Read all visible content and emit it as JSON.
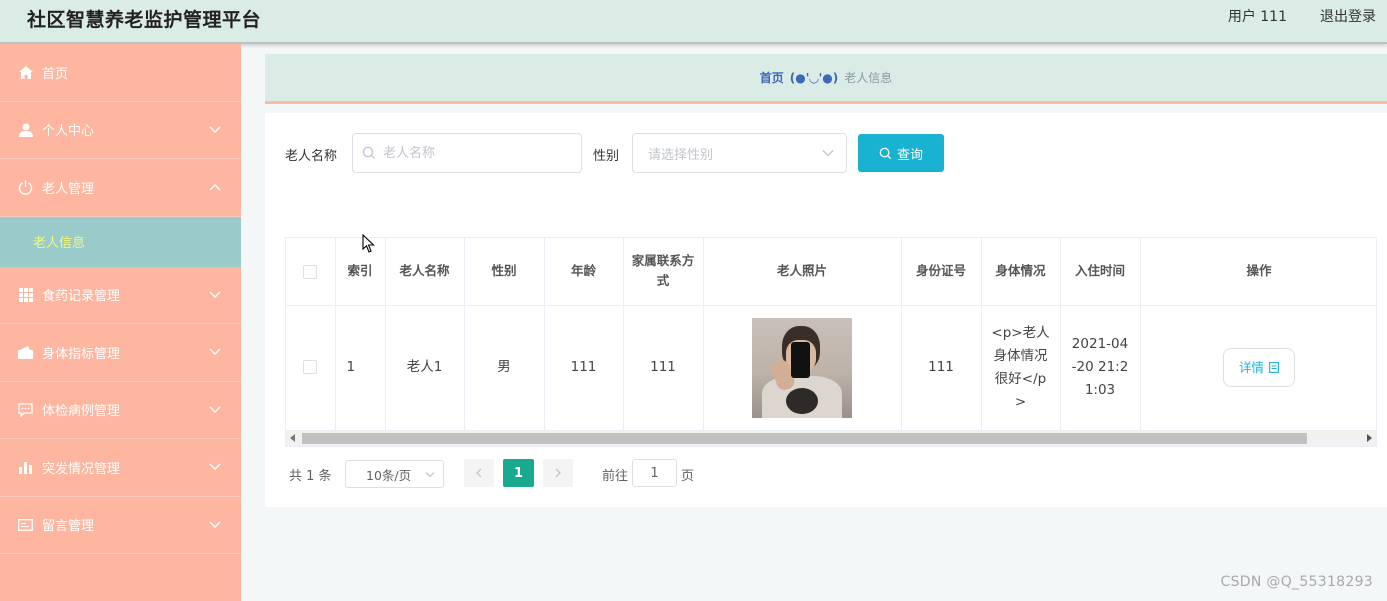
{
  "header": {
    "title": "社区智慧养老监护管理平台",
    "user": "用户 111",
    "logout": "退出登录"
  },
  "sidebar": {
    "items": [
      {
        "label": "首页",
        "icon": "home-icon"
      },
      {
        "label": "个人中心",
        "icon": "user-icon"
      },
      {
        "label": "老人管理",
        "icon": "power-icon"
      },
      {
        "label": "食药记录管理",
        "icon": "grid-icon"
      },
      {
        "label": "身体指标管理",
        "icon": "wallet-icon"
      },
      {
        "label": "体检病例管理",
        "icon": "chat-icon"
      },
      {
        "label": "突发情况管理",
        "icon": "bar-chart-icon"
      },
      {
        "label": "留言管理",
        "icon": "id-card-icon"
      }
    ],
    "active_sub": "老人信息"
  },
  "breadcrumb": {
    "home": "首页",
    "face": "(●'◡'●)",
    "current": "老人信息"
  },
  "search": {
    "name_label": "老人名称",
    "name_placeholder": "老人名称",
    "gender_label": "性别",
    "gender_placeholder": "请选择性别",
    "query_label": "查询"
  },
  "table": {
    "headers": [
      "索引",
      "老人名称",
      "性别",
      "年龄",
      "家属联系方式",
      "老人照片",
      "身份证号",
      "身体情况",
      "入住时间",
      "操作"
    ],
    "rows": [
      {
        "index": "1",
        "name": "老人1",
        "gender": "男",
        "age": "111",
        "contact": "111",
        "id_number": "111",
        "health": "<p>老人身体情况很好</p>",
        "checkin": "2021-04-20 21:21:03",
        "action": "详情"
      }
    ]
  },
  "pagination": {
    "total": "共 1 条",
    "page_size": "10条/页",
    "current_page": "1",
    "goto_label": "前往",
    "goto_value": "1",
    "goto_suffix": "页"
  },
  "watermark": "CSDN @Q_55318293",
  "colors": {
    "sidebar": "#feb6a1",
    "header": "#dbebe6",
    "accent": "#19b3d1",
    "active_page": "#1aa98f",
    "submenu": "#9acbca"
  }
}
